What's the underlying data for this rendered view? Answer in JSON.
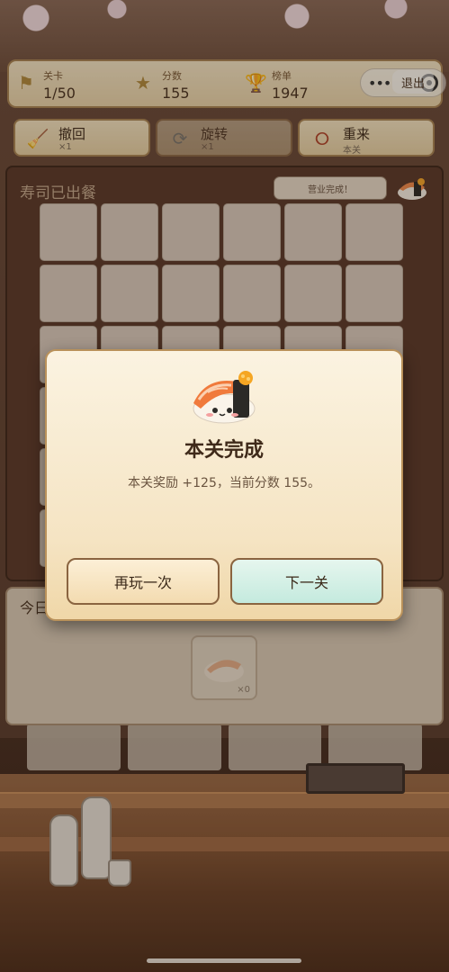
{
  "status": {
    "level_label": "关卡",
    "level_value": "1/50",
    "score_label": "分数",
    "score_value": "155",
    "rank_label": "榜单",
    "rank_value": "1947",
    "exit_label": "退出"
  },
  "tools": {
    "undo_label": "撤回",
    "undo_count": "×1",
    "rotate_label": "旋转",
    "rotate_count": "×1",
    "restart_label": "重来",
    "restart_sub": "本关"
  },
  "board": {
    "title": "寿司已出餐",
    "badge": "营业完成！",
    "rows": 6,
    "cols": 6
  },
  "inventory": {
    "title": "今日",
    "slot_count": "×0"
  },
  "modal": {
    "title": "本关完成",
    "message": "本关奖励 +125，当前分数 155。",
    "replay_label": "再玩一次",
    "next_label": "下一关"
  },
  "colors": {
    "accent_border": "#a88454",
    "next_button": "#c4eade",
    "replay_button": "#f3dbb0"
  },
  "icons": {
    "level": "flag-icon",
    "score": "star-icon",
    "rank": "trophy-icon",
    "undo": "broom-icon",
    "rotate": "rotate-icon",
    "restart": "restart-icon"
  }
}
